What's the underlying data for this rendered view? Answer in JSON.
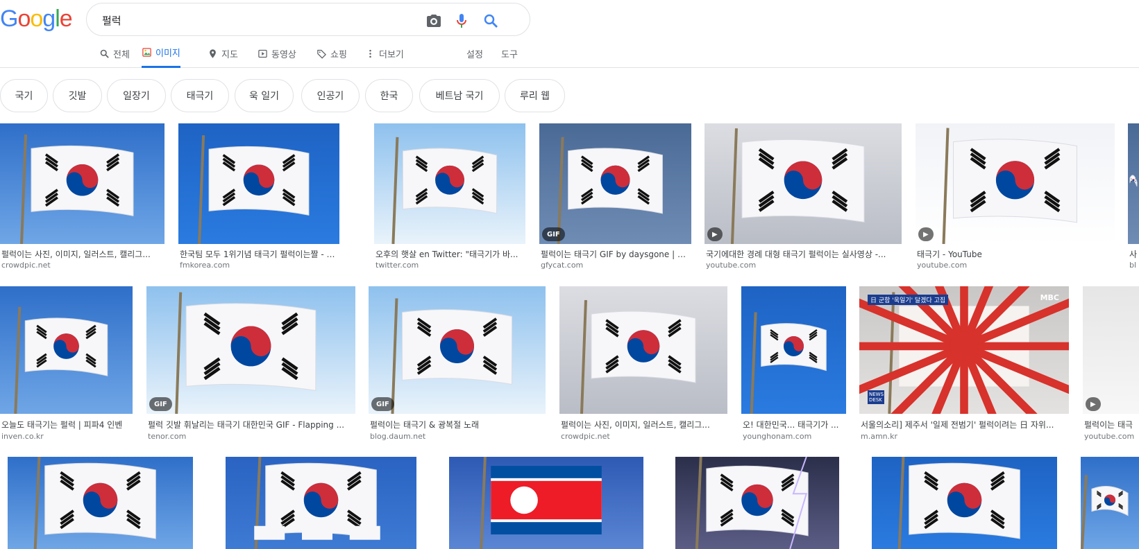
{
  "logo": {
    "letters": [
      "G",
      "o",
      "o",
      "g",
      "l",
      "e"
    ],
    "colors": [
      "#4285f4",
      "#ea4335",
      "#fbbc05",
      "#4285f4",
      "#34a853",
      "#ea4335"
    ]
  },
  "search": {
    "query": "펄럭",
    "camera_icon": "camera-icon",
    "mic_icon": "microphone-icon",
    "search_icon": "search-icon"
  },
  "nav": {
    "all": "전체",
    "images": "이미지",
    "maps": "지도",
    "videos": "동영상",
    "shopping": "쇼핑",
    "more": "더보기",
    "settings": "설정",
    "tools": "도구"
  },
  "chips": [
    "국기",
    "깃발",
    "일장기",
    "태극기",
    "욱 일기",
    "인공기",
    "한국",
    "베트남 국기",
    "루리 웹"
  ],
  "row1": [
    {
      "caption": "펄럭이는 사진, 이미지, 일러스트, 캘리그...",
      "source": "crowdpic.net",
      "badge": ""
    },
    {
      "caption": "한국팀 모두 1위기념 태극기 펄럭이는짤 - 리...",
      "source": "fmkorea.com",
      "badge": ""
    },
    {
      "caption": "오후의 햇살 en Twitter: \"태극기가 바...",
      "source": "twitter.com",
      "badge": ""
    },
    {
      "caption": "펄럭이는 태극기 GIF by daysgone | G...",
      "source": "gfycat.com",
      "badge": "GIF"
    },
    {
      "caption": "국기에대한 경례 대형 태극기 펄럭이는 실사영상 -...",
      "source": "youtube.com",
      "badge": "▶"
    },
    {
      "caption": "태극기 - YouTube",
      "source": "youtube.com",
      "badge": "▶"
    },
    {
      "caption": "사",
      "source": "bl",
      "badge": ""
    }
  ],
  "row2": [
    {
      "caption": "오늘도 태극기는 펄럭 | 피파4 인벤",
      "source": "inven.co.kr",
      "badge": ""
    },
    {
      "caption": "펄럭 깃발 휘날리는 태극기 대한민국 GIF - Flapping ...",
      "source": "tenor.com",
      "badge": "GIF"
    },
    {
      "caption": "펄럭이는 태극기 & 광복절 노래",
      "source": "blog.daum.net",
      "badge": "GIF"
    },
    {
      "caption": "펄럭이는 사진, 이미지, 일러스트, 캘리그...",
      "source": "crowdpic.net",
      "badge": ""
    },
    {
      "caption": "오! 대한민국... 태극기가 ...",
      "source": "younghonam.com",
      "badge": ""
    },
    {
      "caption": "서울의소리] 제주서 '일제 전범기' 펄럭이려는 日 자위...",
      "source": "m.amn.kr",
      "badge": ""
    },
    {
      "caption": "펄럭이는 태극",
      "source": "youtube.com",
      "badge": "▶"
    }
  ],
  "row2_overlays": {
    "news_text": "日 군함 '욱일기' 달겠다 고집",
    "mbc": "MBC",
    "newsdesk": "NEWS DESK"
  },
  "row3_count": 6,
  "colors": {
    "accent": "#1a73e8",
    "taeguk_red": "#cd2e3a",
    "taeguk_blue": "#0047a0",
    "sky": "#3b6fbd"
  }
}
